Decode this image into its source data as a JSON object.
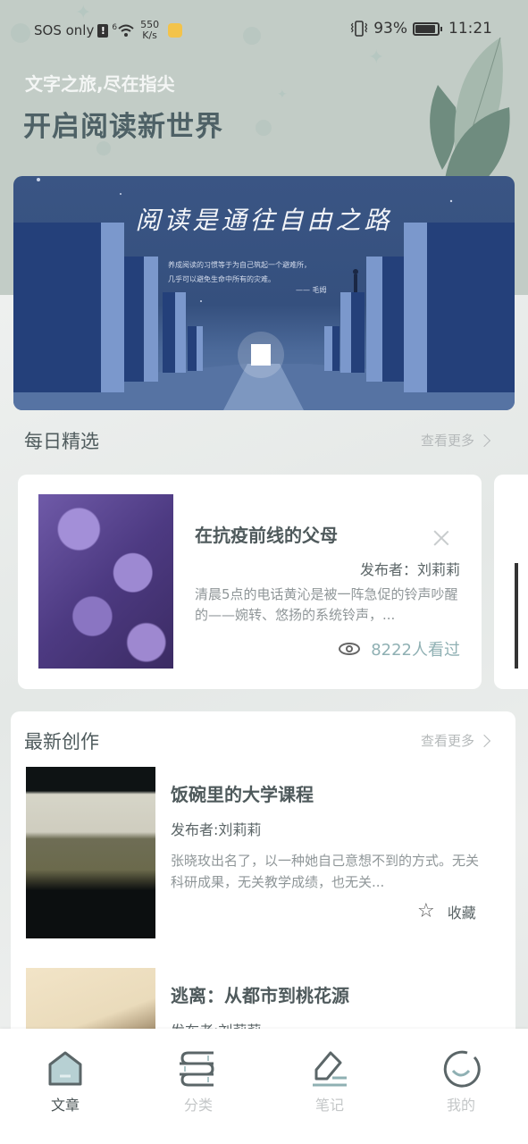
{
  "status_bar": {
    "carrier": "SOS only",
    "network_badge": "6",
    "net_speed_value": "550",
    "net_speed_unit": "K/s",
    "battery_percent": "93%",
    "battery_level": 0.93,
    "time": "11:21",
    "icons": [
      "alert-icon",
      "wifi-icon",
      "app-notification-icon",
      "vibrate-icon",
      "battery-icon"
    ]
  },
  "hero": {
    "subtitle": "文字之旅,尽在指尖",
    "title": "开启阅读新世界"
  },
  "banner": {
    "title": "阅读是通往自由之路",
    "quote_line1": "养成阅读的习惯等于为自己筑起一个避难所，",
    "quote_line2": "几乎可以避免生命中所有的灾难。",
    "quote_author": "—— 毛姆"
  },
  "daily": {
    "section_title": "每日精选",
    "see_more": "查看更多",
    "card": {
      "title": "在抗疫前线的父母",
      "author": "发布者：刘莉莉",
      "excerpt": "清晨5点的电话黄沁是被一阵急促的铃声吵醒的——婉转、悠扬的系统铃声，...",
      "views": "8222人看过",
      "image": "lilac-flowers-photo"
    }
  },
  "latest": {
    "section_title": "最新创作",
    "see_more": "查看更多",
    "articles": [
      {
        "title": "饭碗里的大学课程",
        "author": "发布者:刘莉莉",
        "excerpt": "张晓玫出名了，以一种她自己意想不到的方式。无关科研成果，无关教学成绩，也无关...",
        "favorite_label": "收藏",
        "image": "train-window-photo"
      },
      {
        "title": "逃离：从都市到桃花源",
        "author": "发布者:刘莉莉",
        "image": "mountain-valley-photo"
      }
    ]
  },
  "bottom_nav": {
    "items": [
      {
        "label": "文章",
        "icon": "home-icon",
        "active": true
      },
      {
        "label": "分类",
        "icon": "books-icon",
        "active": false
      },
      {
        "label": "笔记",
        "icon": "pen-icon",
        "active": false
      },
      {
        "label": "我的",
        "icon": "smile-icon",
        "active": false
      }
    ]
  },
  "colors": {
    "header_bg": "#c2ccc6",
    "banner_bg": "#35507e",
    "accent_teal": "#8fb0b3",
    "title_text": "#4f5a5c",
    "muted_text": "#8f9698"
  }
}
